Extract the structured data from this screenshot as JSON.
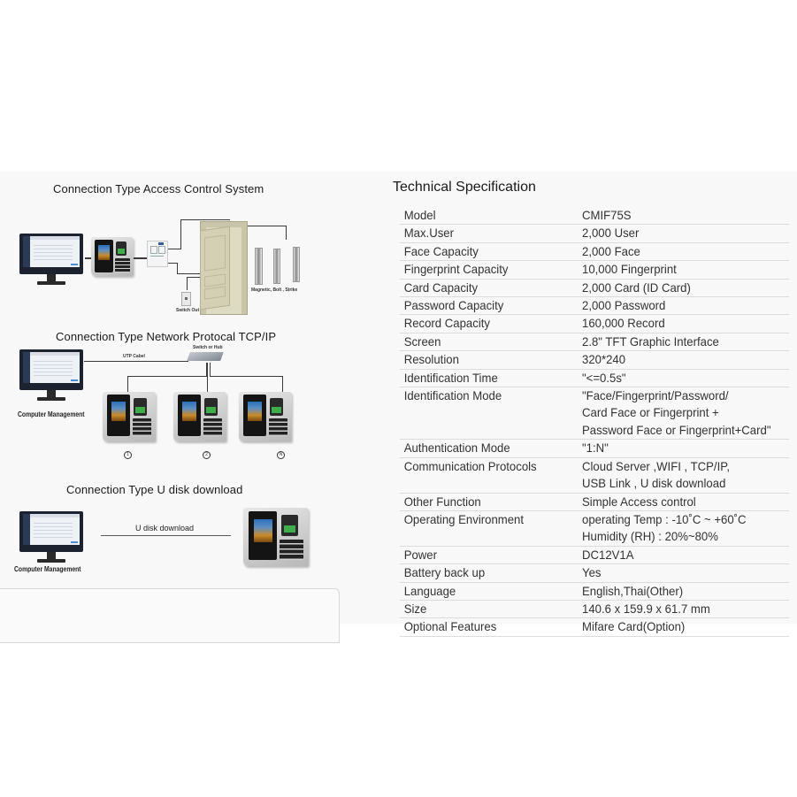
{
  "diagrams": {
    "access_control": {
      "title": "Connection Type Access Control System",
      "lock_label": "Magnetic, Bolt , Strike",
      "switch_label": "Switch Out"
    },
    "network": {
      "title": "Connection Type Network Protocal TCP/IP",
      "cable_label": "UTP Cabel",
      "hub_label": "Switch or Hub",
      "computer_label": "Computer Management",
      "device_markers": [
        "1",
        "2",
        "N"
      ]
    },
    "udisk": {
      "title": "Connection Type  U disk download",
      "link_label": "U disk download",
      "computer_label": "Computer Management"
    }
  },
  "spec": {
    "title": "Technical Specification",
    "rows": [
      {
        "label": "Model",
        "value": [
          "CMIF75S"
        ]
      },
      {
        "label": "Max.User",
        "value": [
          "2,000 User"
        ]
      },
      {
        "label": "Face Capacity",
        "value": [
          "2,000 Face"
        ]
      },
      {
        "label": "Fingerprint Capacity",
        "value": [
          "10,000 Fingerprint"
        ]
      },
      {
        "label": "Card Capacity",
        "value": [
          "2,000 Card (ID Card)"
        ]
      },
      {
        "label": "Password Capacity",
        "value": [
          "2,000 Password"
        ]
      },
      {
        "label": "Record Capacity",
        "value": [
          "160,000 Record"
        ]
      },
      {
        "label": "Screen",
        "value": [
          "2.8\" TFT Graphic Interface"
        ]
      },
      {
        "label": "Resolution",
        "value": [
          "320*240"
        ]
      },
      {
        "label": "Identification Time",
        "value": [
          "\"<=0.5s\""
        ]
      },
      {
        "label": "Identification Mode",
        "value": [
          "\"Face/Fingerprint/Password/",
          "Card Face or Fingerprint +",
          "Password Face or Fingerprint+Card\""
        ]
      },
      {
        "label": "Authentication Mode",
        "value": [
          "\"1:N\""
        ]
      },
      {
        "label": "Communication Protocols",
        "value": [
          "Cloud Server ,WIFI , TCP/IP,",
          "USB Link , U disk download"
        ]
      },
      {
        "label": "Other Function",
        "value": [
          "Simple Access control"
        ]
      },
      {
        "label": "Operating Environment",
        "value": [
          "operating Temp : -10˚C ~ +60˚C",
          "Humidity (RH) : 20%~80%"
        ]
      },
      {
        "label": "Power",
        "value": [
          "DC12V1A"
        ]
      },
      {
        "label": "Battery back up",
        "value": [
          "Yes"
        ]
      },
      {
        "label": "Language",
        "value": [
          "English,Thai(Other)"
        ]
      },
      {
        "label": "Size",
        "value": [
          "140.6 x 159.9 x 61.7 mm"
        ]
      },
      {
        "label": "Optional Features",
        "value": [
          "Mifare Card(Option)"
        ]
      }
    ]
  }
}
